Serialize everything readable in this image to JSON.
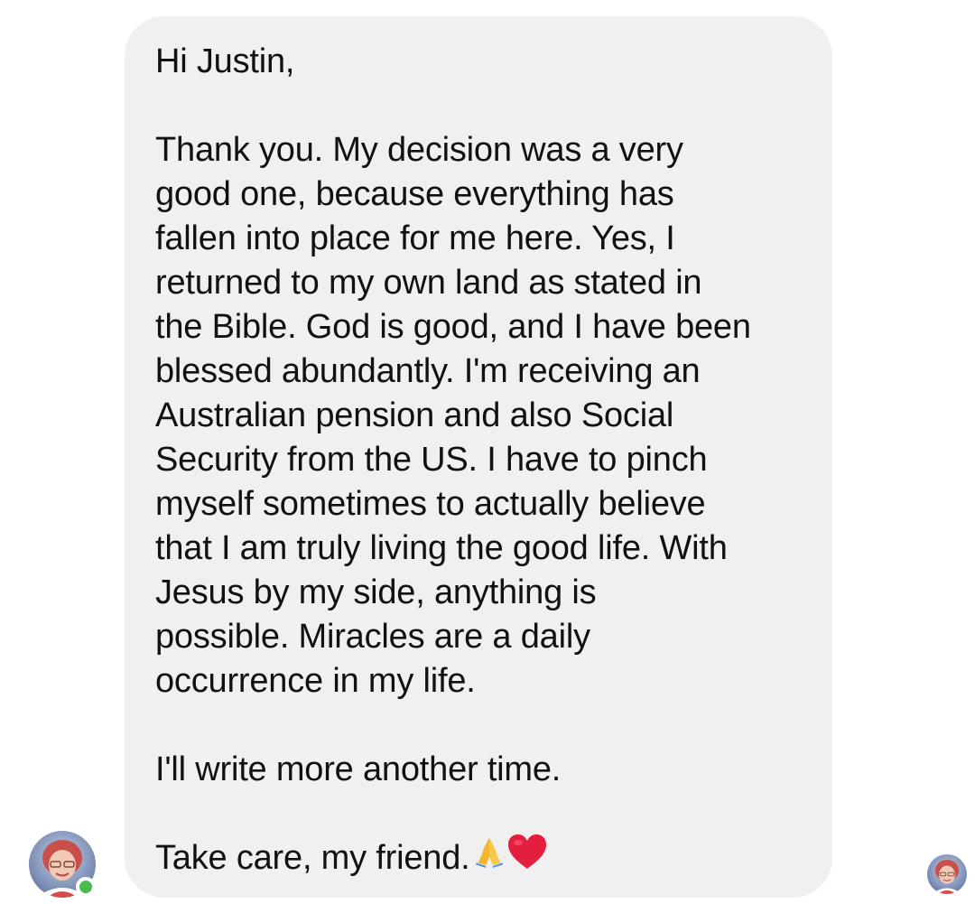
{
  "message": {
    "greeting": "Hi Justin,",
    "body_lines": [
      "Thank you. My decision was a very",
      "good one, because everything has",
      "fallen into place for me here. Yes, I",
      "returned to my own land as stated in",
      "the Bible. God is good, and I have been",
      "blessed abundantly. I'm receiving an",
      "Australian pension and also Social",
      "Security from the US. I have to pinch",
      "myself sometimes to actually believe",
      "that I am truly living the good life. With",
      "Jesus by my side, anything is",
      "possible. Miracles are a daily",
      "occurrence in my life."
    ],
    "closing_line": "I'll write more another time.",
    "signoff": "Take care, my friend.",
    "emoji_pray": "🙏",
    "emoji_heart": "❤"
  },
  "sender": {
    "online": true,
    "status_color": "#45bd4f"
  },
  "colors": {
    "bubble_background": "#f0f0f0",
    "text": "#111111",
    "heart": "#e41e3f"
  },
  "icons": {
    "sender_avatar": "sender-avatar",
    "read_receipt_avatar": "read-receipt-avatar",
    "online_indicator": "online-dot-icon"
  }
}
